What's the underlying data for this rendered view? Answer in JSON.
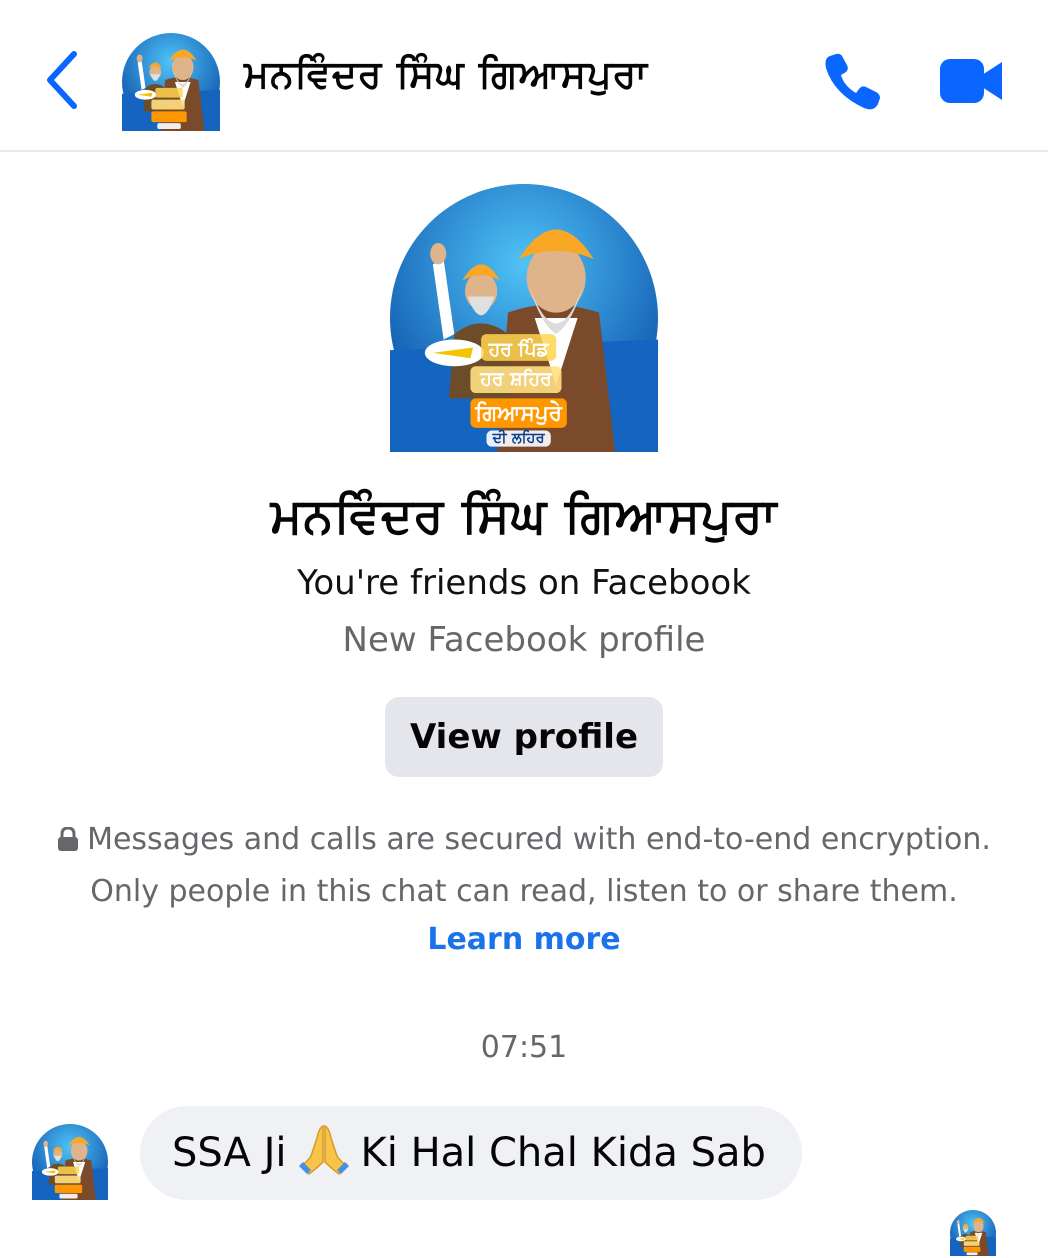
{
  "header": {
    "contact_name": "ਮਨਵਿੰਦਰ ਸਿੰਘ ਗਿਆਸਪੁਰਾ"
  },
  "profile": {
    "name": "ਮਨਵਿੰਦਰ ਸਿੰਘ ਗਿਆਸਪੁਰਾ",
    "friends_text": "You're friends on Facebook",
    "subtitle": "New Facebook profile",
    "view_profile_label": "View profile",
    "avatar_poster_text": [
      "ਹਰ ਪਿੰਡ",
      "ਹਰ ਸ਼ਹਿਰ",
      "ਗਿਆਸਪੁਰੇ",
      "ਦੀ ਲਹਿਰ"
    ]
  },
  "encryption": {
    "line1": "Messages and calls are secured with end-to-end encryption.",
    "line2": "Only people in this chat can read, listen to or share them.",
    "learn_more": "Learn more"
  },
  "conversation": {
    "timestamp": "07:51",
    "messages": [
      {
        "from": "contact",
        "text_before": "SSA Ji",
        "emoji": "folded-hands",
        "text_after": "Ki Hal Chal Kida Sab"
      }
    ]
  },
  "colors": {
    "accent": "#0a66ff",
    "link": "#1a73e8",
    "bubble": "#eff1f4",
    "button": "#e4e6eb",
    "secondary_text": "#65676b"
  }
}
